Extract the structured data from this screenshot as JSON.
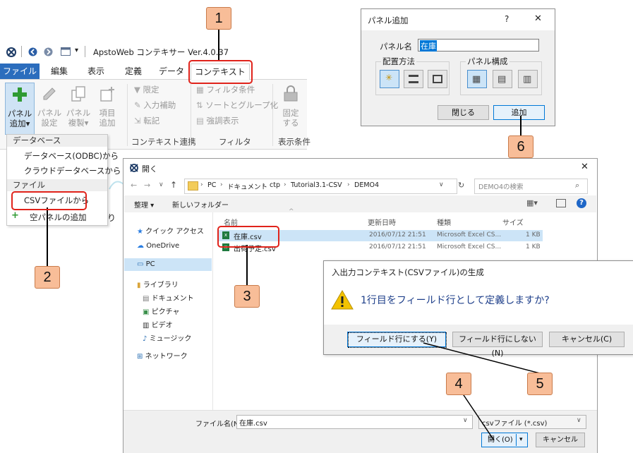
{
  "app": {
    "title": "ApstoWeb コンテキサー Ver.4.0.37",
    "tabs": [
      "ファイル",
      "編集",
      "表示",
      "定義",
      "データ",
      "コンテキスト"
    ],
    "ribbon": {
      "panel_add": "パネル\n追加▾",
      "panel_settings": "パネル\n設定",
      "panel_duplicate": "パネル\n複製▾",
      "add_item": "項目\n追加",
      "limit": "限定",
      "input_assist": "入力補助",
      "transcribe": "転記",
      "filter_condition": "フィルタ条件",
      "sort_group": "ソートとグループ化",
      "highlight": "強調表示",
      "fix": "固定\nする",
      "group_context_link": "コンテキスト連携",
      "group_filter": "フィルタ",
      "group_display": "表示条件"
    },
    "menu": {
      "db_header": "データベース",
      "db_odbc": "データベース(ODBC)から",
      "cloud_db": "クラウドデータベースから",
      "file_header": "ファイル",
      "csv_file": "CSVファイルから",
      "empty_panel": "空パネルの追加"
    }
  },
  "open_dialog": {
    "title": "開く",
    "breadcrumb": [
      "PC",
      "ドキュメント",
      "ctp",
      "Tutorial3.1-CSV",
      "DEMO4"
    ],
    "search_placeholder": "DEMO4の検索",
    "organize": "整理 ▾",
    "new_folder": "新しいフォルダー",
    "nav": [
      "クイック アクセス",
      "OneDrive",
      "PC",
      "ライブラリ",
      "ドキュメント",
      "ピクチャ",
      "ビデオ",
      "ミュージック",
      "ネットワーク"
    ],
    "columns": [
      "名前",
      "更新日時",
      "種類",
      "サイズ"
    ],
    "files": [
      {
        "name": "在庫.csv",
        "date": "2016/07/12 21:51",
        "type": "Microsoft Excel CS...",
        "size": "1 KB"
      },
      {
        "name": "出荷予定.csv",
        "date": "2016/07/12 21:51",
        "type": "Microsoft Excel CS...",
        "size": "1 KB"
      }
    ],
    "filename_label": "ファイル名(N):",
    "filename_value": "在庫.csv",
    "filetype": "csvファイル (*.csv)",
    "open_button": "開く(O)",
    "cancel_button": "キャンセル"
  },
  "prompt": {
    "title": "入出力コンテキスト(CSVファイル)の生成",
    "message": "1行目をフィールド行として定義しますか?",
    "yes": "フィールド行にする(Y)",
    "no": "フィールド行にしない(N)",
    "cancel": "キャンセル(C)"
  },
  "panel_dialog": {
    "title": "パネル追加",
    "help": "?",
    "close": "✕",
    "name_label": "パネル名",
    "name_value": "在庫",
    "layout_label": "配置方法",
    "structure_label": "パネル構成",
    "close_button": "閉じる",
    "add_button": "追加"
  },
  "callouts": [
    "1",
    "2",
    "3",
    "4",
    "5",
    "6"
  ],
  "colors": {
    "accent": "#2b6dbd",
    "callout": "#f8bd98",
    "highlight": "#e0231b"
  }
}
